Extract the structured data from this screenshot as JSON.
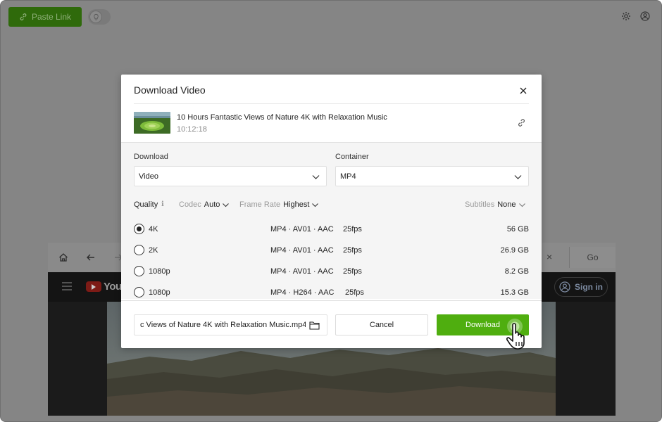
{
  "app": {
    "paste_link_label": "Paste Link"
  },
  "browser": {
    "go_label": "Go",
    "close_symbol": "×"
  },
  "youtube": {
    "logo_text": "YouTube",
    "sign_in_label": "Sign in"
  },
  "dialog": {
    "title": "Download Video",
    "video": {
      "title": "10 Hours Fantastic Views of Nature 4K with Relaxation Music",
      "duration": "10:12:18"
    },
    "download_label": "Download",
    "download_value": "Video",
    "container_label": "Container",
    "container_value": "MP4",
    "filters": {
      "quality_label": "Quality",
      "quality_info_icon": "ℹ",
      "codec_label": "Codec",
      "codec_value": "Auto",
      "frame_rate_label": "Frame Rate",
      "frame_rate_value": "Highest",
      "subtitles_label": "Subtitles",
      "subtitles_value": "None"
    },
    "qualities": [
      {
        "resolution": "4K",
        "format": "MP4 · AV01 · AAC",
        "fps": "25fps",
        "size": "56 GB",
        "selected": true
      },
      {
        "resolution": "2K",
        "format": "MP4 · AV01 · AAC",
        "fps": "25fps",
        "size": "26.9 GB",
        "selected": false
      },
      {
        "resolution": "1080p",
        "format": "MP4 · AV01 · AAC",
        "fps": "25fps",
        "size": "8.2 GB",
        "selected": false
      },
      {
        "resolution": "1080p",
        "format": "MP4 · H264 · AAC",
        "fps": "25fps",
        "size": "15.3 GB",
        "selected": false
      }
    ],
    "filename": "c Views of Nature 4K with Relaxation Music.mp4",
    "cancel_label": "Cancel",
    "download_button_label": "Download"
  },
  "colors": {
    "accent_green": "#4fae0f",
    "overlay_gray": "#858585"
  },
  "icons": [
    "paste-link-icon",
    "lightbulb-icon",
    "gear-icon",
    "account-icon",
    "home-icon",
    "back-arrow-icon",
    "forward-arrow-icon",
    "menu-icon",
    "close-icon",
    "link-icon",
    "chevron-down-icon",
    "folder-icon",
    "hand-cursor-icon"
  ]
}
